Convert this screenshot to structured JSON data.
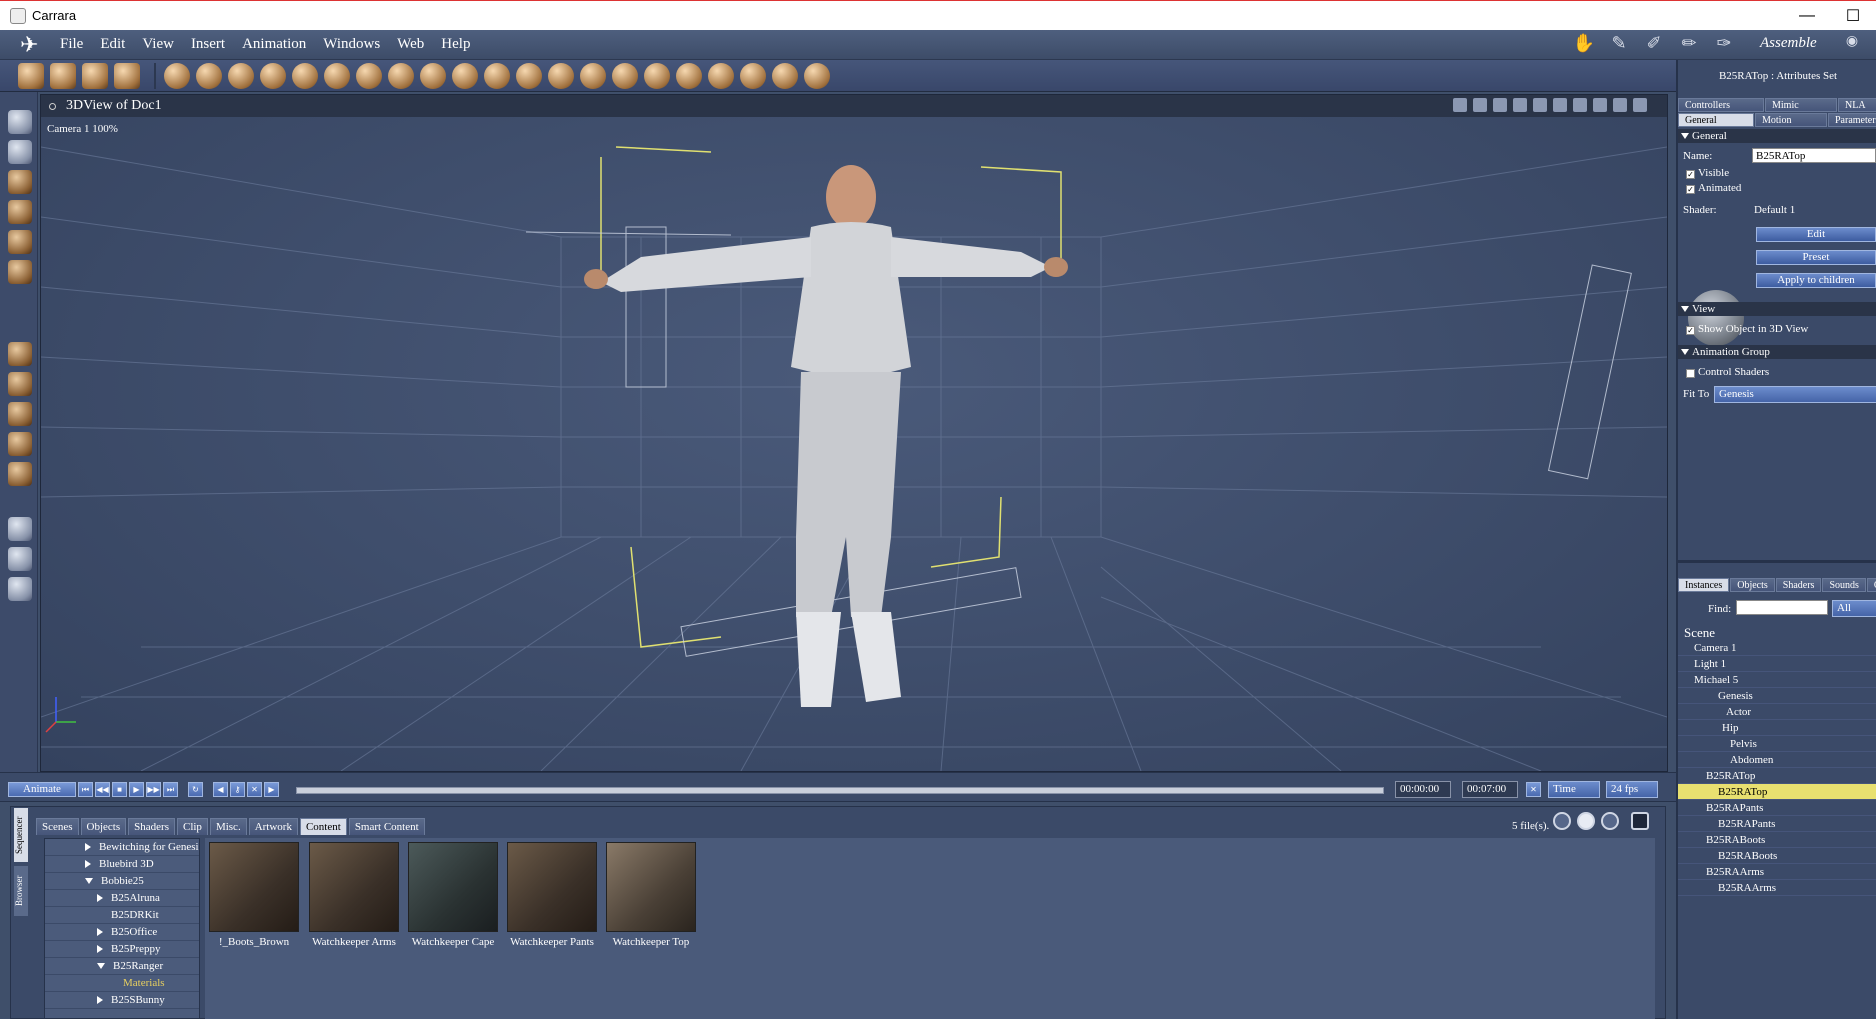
{
  "window": {
    "title": "Carrara",
    "minimize": "—",
    "maximize": "☐"
  },
  "menu": {
    "items": [
      "File",
      "Edit",
      "View",
      "Insert",
      "Animation",
      "Windows",
      "Web",
      "Help"
    ],
    "room": "Assemble"
  },
  "viewport": {
    "title": "3DView of Doc1",
    "camera_label": "Camera 1 100%"
  },
  "timeline": {
    "animate": "Animate",
    "time_start": "00:00:00",
    "time_end": "00:07:00",
    "mode": "Time",
    "fps": "24 fps"
  },
  "browser": {
    "side_tabs": [
      "Sequencer",
      "Browser"
    ],
    "tabs": [
      "Scenes",
      "Objects",
      "Shaders",
      "Clip",
      "Misc.",
      "Artwork",
      "Content",
      "Smart Content"
    ],
    "active_tab": "Content",
    "file_count": "5 file(s).",
    "tree": [
      {
        "label": "Bewitching for Genesis",
        "state": "closed",
        "indent": 0
      },
      {
        "label": "Bluebird 3D",
        "state": "closed",
        "indent": 0
      },
      {
        "label": "Bobbie25",
        "state": "open",
        "indent": 0
      },
      {
        "label": "B25Alruna",
        "state": "closed",
        "indent": 1
      },
      {
        "label": "B25DRKit",
        "state": "none",
        "indent": 1
      },
      {
        "label": "B25Office",
        "state": "closed",
        "indent": 1
      },
      {
        "label": "B25Preppy",
        "state": "closed",
        "indent": 1
      },
      {
        "label": "B25Ranger",
        "state": "open",
        "indent": 1
      },
      {
        "label": "Materials",
        "state": "none",
        "indent": 2,
        "highlight": true
      },
      {
        "label": "B25SBunny",
        "state": "closed",
        "indent": 1
      }
    ],
    "thumbnails": [
      "!_Boots_Brown",
      "Watchkeeper Arms",
      "Watchkeeper Cape",
      "Watchkeeper Pants",
      "Watchkeeper Top"
    ]
  },
  "properties": {
    "header": "B25RATop : Attributes Set",
    "tabs_row1": [
      "Controllers",
      "Mimic",
      "NLA"
    ],
    "tabs_row2": [
      "General",
      "Motion",
      "Parameters"
    ],
    "general": {
      "section": "General",
      "name_label": "Name:",
      "name_value": "B25RATop",
      "visible": "Visible",
      "animated": "Animated",
      "shader_label": "Shader:",
      "shader_value": "Default 1",
      "edit": "Edit",
      "preset": "Preset",
      "apply": "Apply to children"
    },
    "view": {
      "section": "View",
      "show": "Show Object in 3D View"
    },
    "anim_group": {
      "section": "Animation Group",
      "control": "Control Shaders",
      "fit_label": "Fit To",
      "fit_value": "Genesis"
    }
  },
  "instances": {
    "tabs": [
      "Instances",
      "Objects",
      "Shaders",
      "Sounds",
      "Cl"
    ],
    "find_label": "Find:",
    "find_value": "",
    "filter": "All",
    "scene_label": "Scene",
    "rows": [
      {
        "label": "Camera 1",
        "indent": 0
      },
      {
        "label": "Light 1",
        "indent": 0
      },
      {
        "label": "Michael 5",
        "indent": 0
      },
      {
        "label": "Genesis",
        "indent": 1
      },
      {
        "label": "Actor",
        "indent": 2
      },
      {
        "label": "Hip",
        "indent": 2
      },
      {
        "label": "Pelvis",
        "indent": 3
      },
      {
        "label": "Abdomen",
        "indent": 3
      },
      {
        "label": "B25RATop",
        "indent": 1
      },
      {
        "label": "B25RATop",
        "indent": 2,
        "selected": true
      },
      {
        "label": "B25RAPants",
        "indent": 1
      },
      {
        "label": "B25RAPants",
        "indent": 2
      },
      {
        "label": "B25RABoots",
        "indent": 1
      },
      {
        "label": "B25RABoots",
        "indent": 2
      },
      {
        "label": "B25RAArms",
        "indent": 1
      },
      {
        "label": "B25RAArms",
        "indent": 2
      }
    ]
  }
}
